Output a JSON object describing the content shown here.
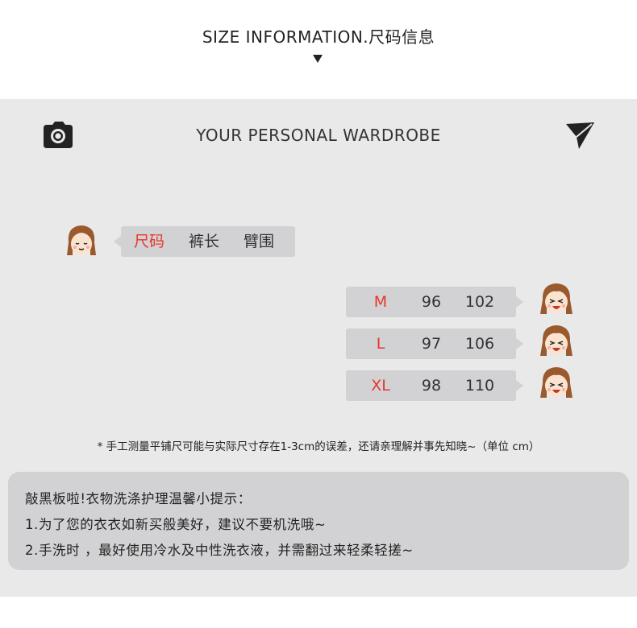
{
  "header": {
    "title": "SIZE INFORMATION.尺码信息"
  },
  "panel": {
    "title": "YOUR PERSONAL WARDROBE",
    "icons": {
      "left": "camera-icon",
      "right": "send-icon"
    }
  },
  "size_table": {
    "headers": [
      "尺码",
      "裤长",
      "臂围"
    ],
    "rows": [
      {
        "size": "M",
        "length": "96",
        "arm": "102"
      },
      {
        "size": "L",
        "length": "97",
        "arm": "106"
      },
      {
        "size": "XL",
        "length": "98",
        "arm": "110"
      }
    ]
  },
  "note": "* 手工测量平铺尺可能与实际尺寸存在1-3cm的误差，还请亲理解并事先知晓~（单位 cm）",
  "care": {
    "lines": [
      "敲黑板啦!衣物洗涤护理温馨小提示：",
      "1.为了您的衣衣如新买般美好，建议不要机洗哦~",
      "2.手洗时 ，最好使用冷水及中性洗衣液，并需翻过来轻柔轻搓~"
    ]
  },
  "colors": {
    "accent_red": "#e6372b",
    "panel_bg": "#e9e9ea",
    "bubble_bg": "#d2d2d4",
    "hair": "#9a5a2e",
    "skin": "#fbe3cf"
  }
}
